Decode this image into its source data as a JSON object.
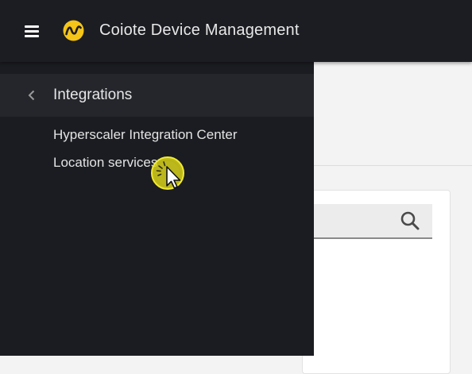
{
  "header": {
    "menu_icon": "hamburger-menu-icon",
    "logo_icon": "coiote-logo-icon",
    "brand_color": "#f5c518",
    "title": "Coiote Device Management"
  },
  "drawer": {
    "back_icon": "chevron-left-icon",
    "title": "Integrations",
    "items": [
      {
        "label": "Hyperscaler Integration Center"
      },
      {
        "label": "Location services"
      }
    ]
  },
  "main": {
    "search": {
      "icon": "search-icon"
    }
  },
  "cursor": {
    "icon": "pointer-cursor-icon",
    "highlight_color": "#e8e020"
  }
}
